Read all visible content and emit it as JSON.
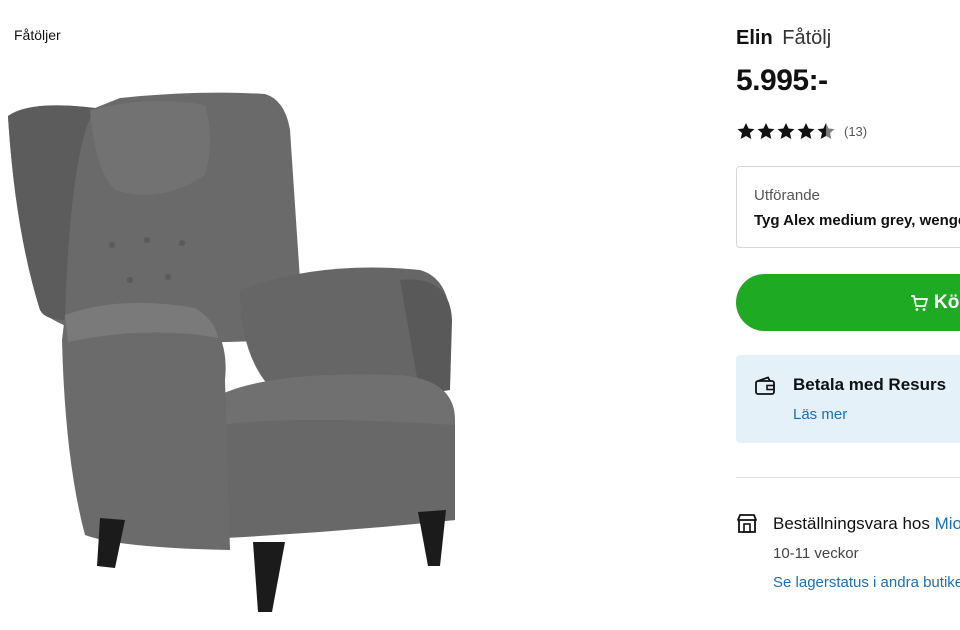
{
  "breadcrumb": {
    "label": "Fåtöljer"
  },
  "product": {
    "brand": "Elin",
    "name": "Fåtölj",
    "price": "5.995:-",
    "image_icon": "armchair-image"
  },
  "rating": {
    "stars": 4.5,
    "max": 5,
    "count_label": "(13)"
  },
  "variant": {
    "label": "Utförande",
    "value": "Tyg Alex medium grey, wengéb"
  },
  "buy": {
    "label": "Köp",
    "icon": "cart-icon",
    "color": "#1faa23"
  },
  "payment": {
    "title": "Betala med Resurs",
    "link": "Läs mer",
    "icon": "wallet-icon",
    "background": "#e5f1f9"
  },
  "availability": {
    "title": "Beställningsvara hos",
    "store": "Mio",
    "time": "10-11 veckor",
    "link": "Se lagerstatus i andra butike",
    "icon": "store-icon"
  },
  "colors": {
    "link": "#1a6fb5",
    "accent": "#1faa23"
  }
}
